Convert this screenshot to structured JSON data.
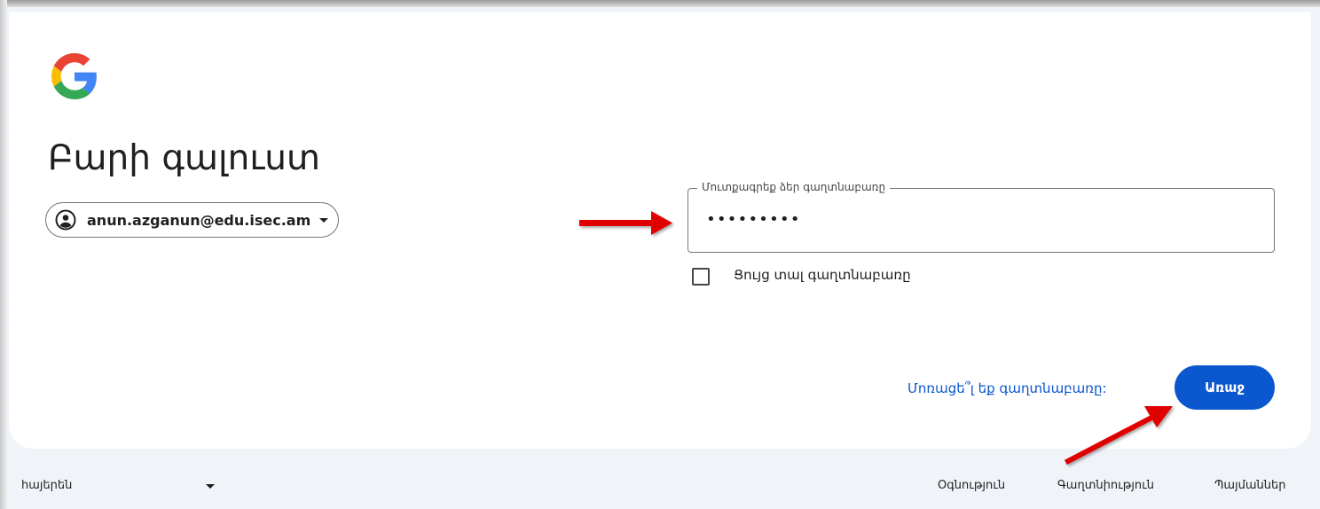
{
  "colors": {
    "accent": "#0b57d0",
    "background": "#f0f4f9",
    "card": "#ffffff",
    "annotation_arrow": "#e00000"
  },
  "logo": {
    "icon": "google-g-logo"
  },
  "header": {
    "title": "Բարի գալուստ"
  },
  "account": {
    "icon": "account-circle-icon",
    "email": "anun.azganun@edu.isec.am",
    "dropdown_icon": "caret-down-icon"
  },
  "password": {
    "label": "Մուտքագրեք ձեր գաղտնաբառը",
    "value": "•••••••••"
  },
  "show_password": {
    "checked": false,
    "label": "Ցույց տալ գաղտնաբառը"
  },
  "actions": {
    "forgot_label": "Մոռացե՞լ եք գաղտնաբառը:",
    "next_label": "Առաջ"
  },
  "footer": {
    "language": "հայերեն",
    "links": [
      "Օգնություն",
      "Գաղտնիություն",
      "Պայմաններ"
    ]
  }
}
